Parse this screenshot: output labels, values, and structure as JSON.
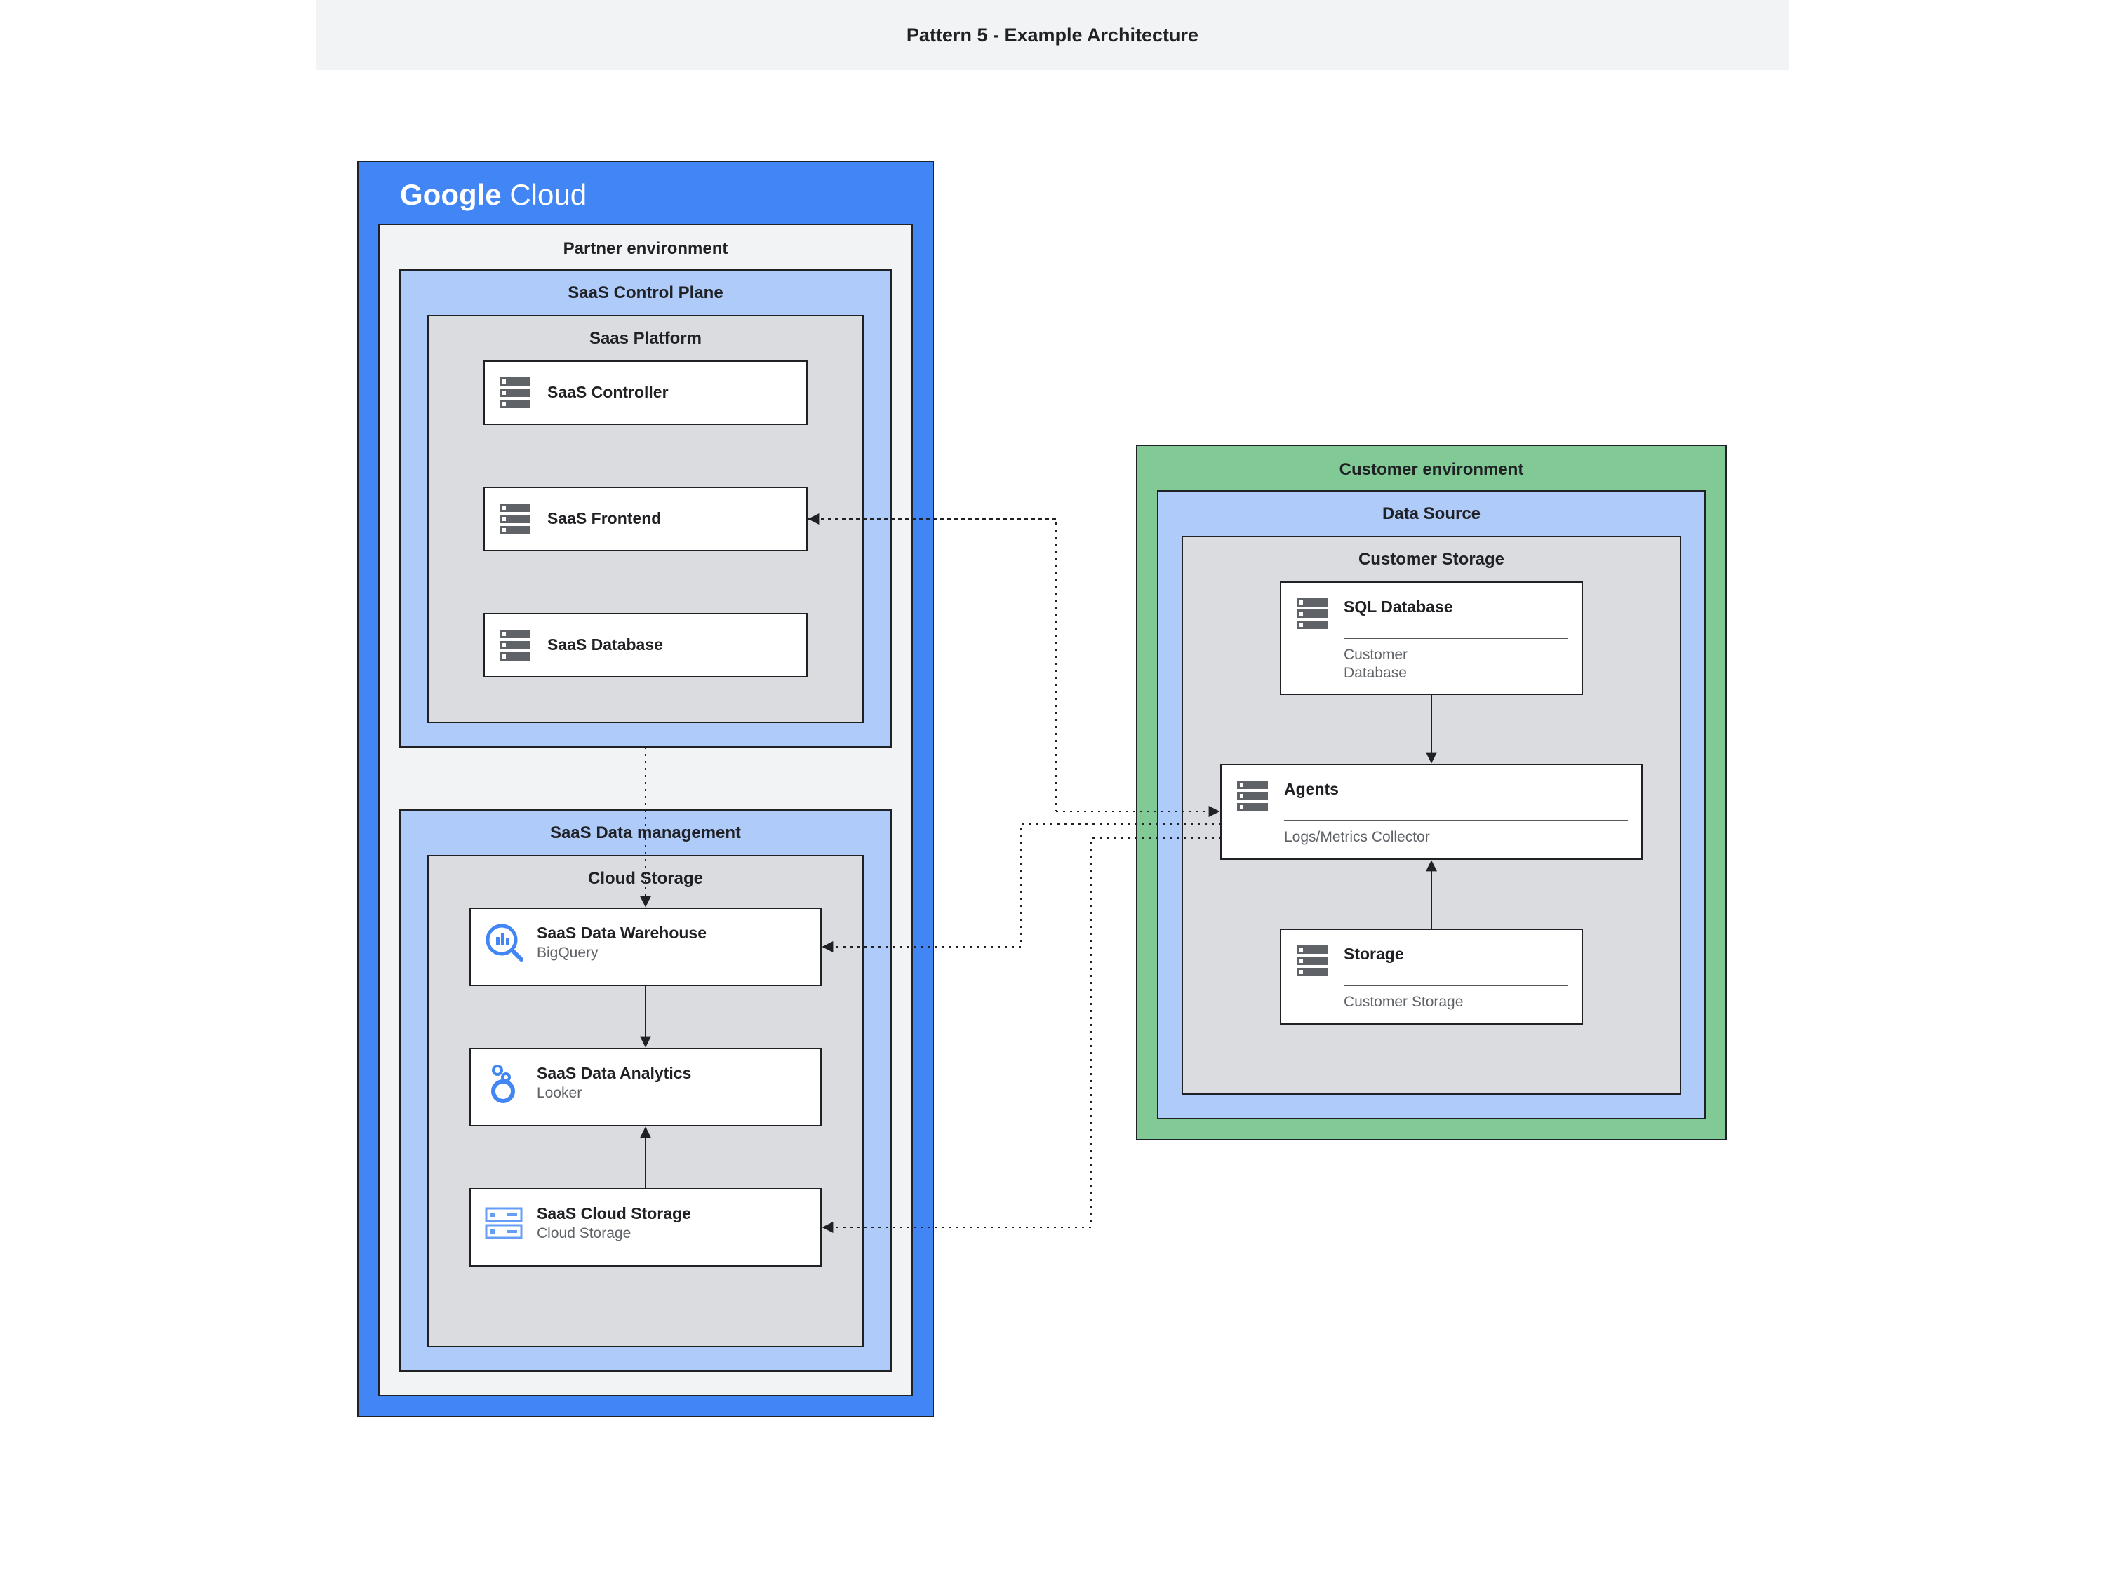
{
  "header": {
    "title": "Pattern 5 - Example Architecture"
  },
  "gcloud": {
    "brand_bold": "Google",
    "brand_light": " Cloud"
  },
  "partner_env": {
    "title": "Partner environment"
  },
  "control_plane": {
    "title": "SaaS Control Plane"
  },
  "saas_platform": {
    "title": "Saas Platform",
    "items": [
      {
        "title": "SaaS Controller"
      },
      {
        "title": "SaaS Frontend"
      },
      {
        "title": "SaaS Database"
      }
    ]
  },
  "data_mgmt": {
    "title": "SaaS Data management"
  },
  "cloud_storage": {
    "title": "Cloud Storage",
    "items": [
      {
        "title": "SaaS Data Warehouse",
        "sub": "BigQuery"
      },
      {
        "title": "SaaS Data Analytics",
        "sub": "Looker"
      },
      {
        "title": "SaaS Cloud Storage",
        "sub": "Cloud Storage"
      }
    ]
  },
  "customer_env": {
    "title": "Customer environment"
  },
  "data_source": {
    "title": "Data Source"
  },
  "customer_storage": {
    "title": "Customer Storage",
    "items": [
      {
        "title": "SQL Database",
        "sub": "Customer",
        "sub2": "Database"
      },
      {
        "title": "Agents",
        "sub": "Logs/Metrics Collector"
      },
      {
        "title": "Storage",
        "sub": "Customer Storage"
      }
    ]
  }
}
